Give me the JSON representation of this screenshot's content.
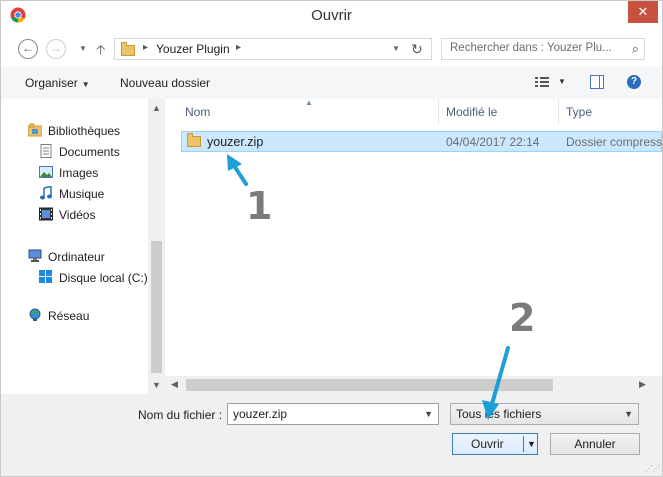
{
  "window": {
    "title": "Ouvrir",
    "close_label": "✕"
  },
  "navigation": {
    "address_segment": "Youzer Plugin",
    "search_placeholder": "Rechercher dans : Youzer Plu..."
  },
  "toolbar": {
    "organize_label": "Organiser",
    "new_folder_label": "Nouveau dossier"
  },
  "sidebar": {
    "libraries": "Bibliothèques",
    "documents": "Documents",
    "images": "Images",
    "music": "Musique",
    "videos": "Vidéos",
    "computer": "Ordinateur",
    "local_disk": "Disque local (C:)",
    "network": "Réseau"
  },
  "file_list": {
    "columns": {
      "name": "Nom",
      "modified": "Modifié le",
      "type": "Type"
    },
    "rows": [
      {
        "name": "youzer.zip",
        "modified": "04/04/2017 22:14",
        "type": "Dossier compress",
        "selected": true
      }
    ]
  },
  "bottom": {
    "filename_label": "Nom du fichier :",
    "filename_value": "youzer.zip",
    "filter_value": "Tous les fichiers",
    "open_label": "Ouvrir",
    "cancel_label": "Annuler"
  },
  "annotations": {
    "step1": "1",
    "step2": "2",
    "arrow_color": "#1b9fd6"
  },
  "colors": {
    "selection": "#cce8ff",
    "close_button": "#c7503e",
    "folder": "#e9c46a"
  }
}
